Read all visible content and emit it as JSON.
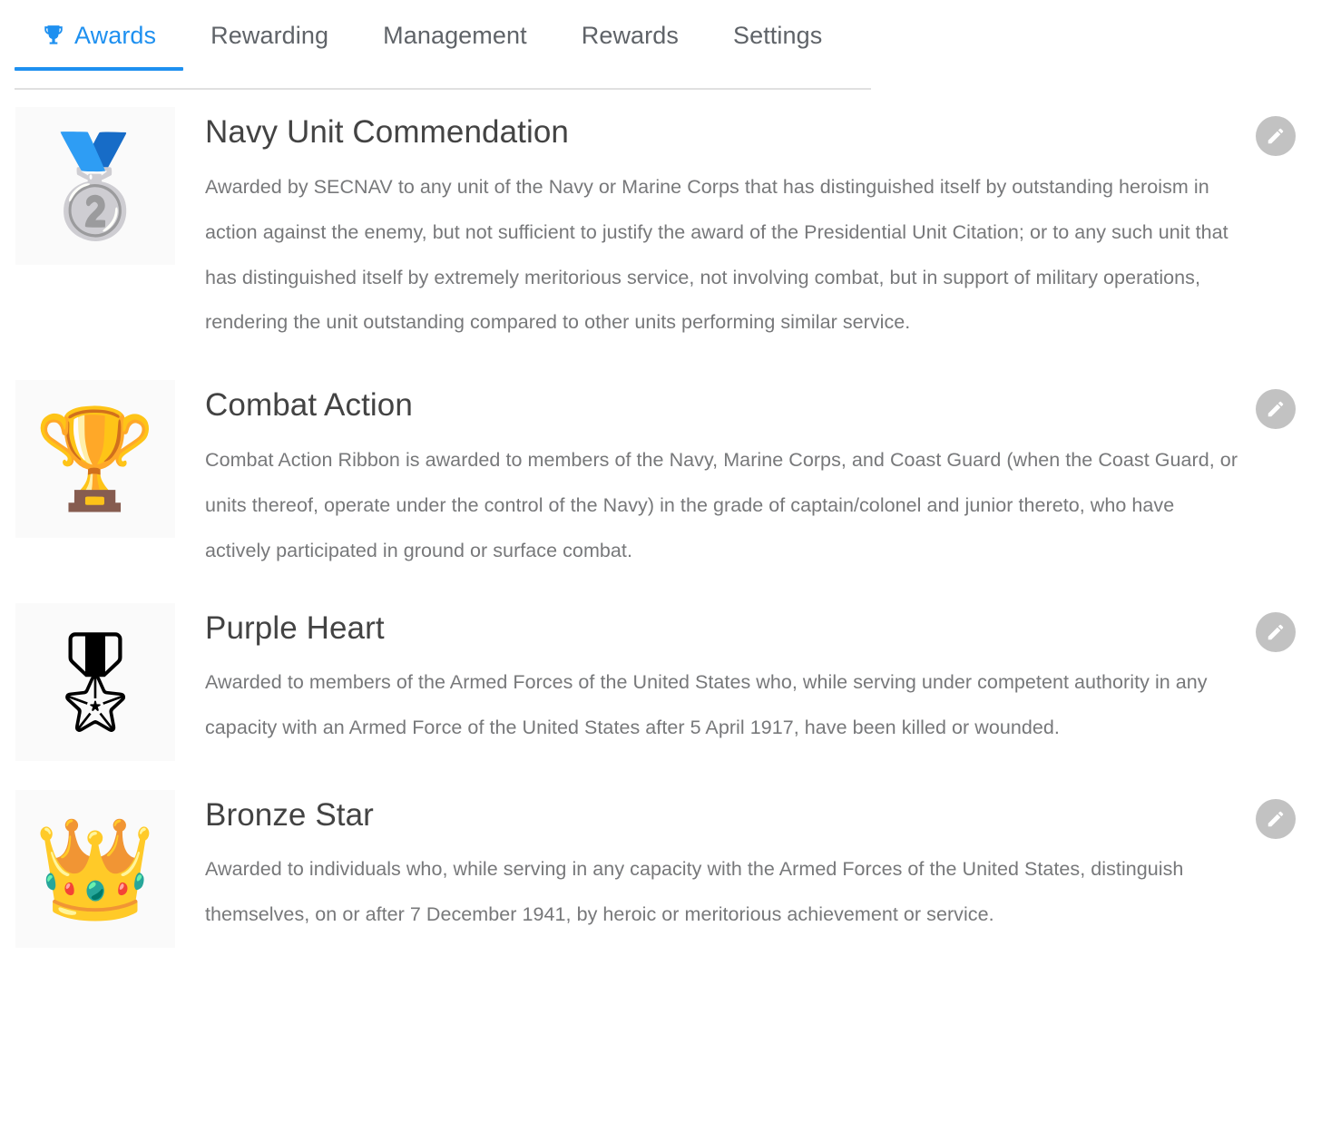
{
  "tabs": [
    {
      "label": "Awards",
      "icon": "trophy-icon",
      "active": true
    },
    {
      "label": "Rewarding",
      "icon": null,
      "active": false
    },
    {
      "label": "Management",
      "icon": null,
      "active": false
    },
    {
      "label": "Rewards",
      "icon": null,
      "active": false
    },
    {
      "label": "Settings",
      "icon": null,
      "active": false
    }
  ],
  "colors": {
    "accent": "#1e90f0",
    "tab_inactive": "#5f6368",
    "title": "#434343",
    "description": "#77787a",
    "thumb_bg": "#fafafa",
    "edit_button_bg": "#c2c2c2",
    "tab_divider": "#e0e0e0"
  },
  "edit_button_label": "Edit",
  "awards": [
    {
      "title": "Navy Unit Commendation",
      "icon": "silver-medal-icon",
      "description": "Awarded by SECNAV to any unit of the Navy or Marine Corps that has distinguished itself by outstanding heroism in action against the enemy, but not sufficient to justify the award of the Presidential Unit Citation; or to any such unit that has distinguished itself by extremely meritorious service, not involving combat, but in support of military operations, rendering the unit outstanding compared to other units performing similar service."
    },
    {
      "title": "Combat Action",
      "icon": "gold-trophy-laurel-icon",
      "description": "Combat Action Ribbon is awarded to members of the Navy, Marine Corps, and Coast Guard (when the Coast Guard, or units thereof, operate under the control of the Navy) in the grade of captain/colonel and junior thereto, who have actively participated in ground or surface combat."
    },
    {
      "title": "Purple Heart",
      "icon": "rosette-ribbon-icon",
      "description": "Awarded to members of the Armed Forces of the United States who, while serving under competent authority in any capacity with an Armed Force of the United States after 5 April 1917, have been killed or wounded."
    },
    {
      "title": "Bronze Star",
      "icon": "crown-icon",
      "description": "Awarded to individuals who, while serving in any capacity with the Armed Forces of the United States, distinguish themselves, on or after 7 December 1941, by heroic or meritorious achievement or service."
    }
  ]
}
